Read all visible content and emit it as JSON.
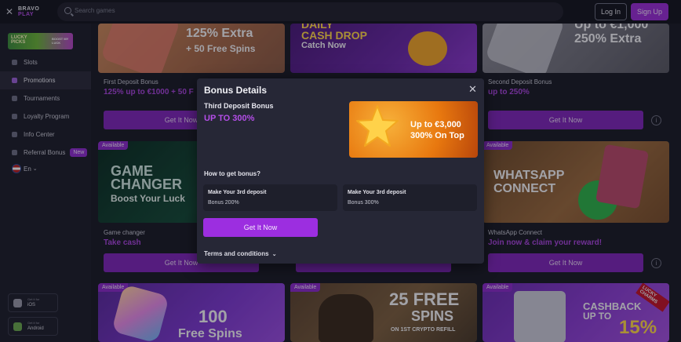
{
  "header": {
    "logo_line1": "BRAVO",
    "logo_line2": "PLAY",
    "search_placeholder": "Search games",
    "login_label": "Log In",
    "signup_label": "Sign Up"
  },
  "sidebar": {
    "promo_banner_line1": "LUCKY",
    "promo_banner_line2": "PICKS",
    "promo_banner_cta": "BOOST MY LUCK",
    "items": [
      {
        "label": "Slots",
        "icon": "slots-icon"
      },
      {
        "label": "Promotions",
        "icon": "promotions-icon",
        "active": true
      },
      {
        "label": "Tournaments",
        "icon": "trophy-icon"
      },
      {
        "label": "Loyalty Program",
        "icon": "crown-icon"
      },
      {
        "label": "Info Center",
        "icon": "info-icon"
      },
      {
        "label": "Referral Bonus",
        "icon": "referral-icon",
        "badge": "New"
      }
    ],
    "language": "En",
    "apps": [
      {
        "line1": "Get it for",
        "line2": "iOS",
        "icon": "apple-icon"
      },
      {
        "line1": "Get it for",
        "line2": "Android",
        "icon": "android-icon"
      }
    ]
  },
  "cards": {
    "first_deposit": {
      "banner_l1": "125% Extra",
      "banner_l2": "+ 50 Free Spins",
      "title": "First Deposit Bonus",
      "sub": "125% up to €1000 + 50 F",
      "btn": "Get It Now"
    },
    "daily_cash": {
      "banner_l1": "DAILY",
      "banner_l2": "CASH DROP",
      "banner_l3": "Catch Now"
    },
    "second_deposit": {
      "banner_l1": "Up to €1,000",
      "banner_l2": "250% Extra",
      "title": "Second Deposit Bonus",
      "sub": "up to 250%",
      "btn": "Get It Now"
    },
    "game_changer": {
      "badge": "Available",
      "banner_l1": "GAME",
      "banner_l2": "CHANGER",
      "banner_l3": "Boost Your Luck",
      "title": "Game changer",
      "sub": "Take cash",
      "btn": "Get It Now"
    },
    "whatsapp": {
      "badge": "Available",
      "banner_l1": "WHATSAPP",
      "banner_l2": "CONNECT",
      "title": "WhatsApp Connect",
      "sub": "Join now & claim your reward!",
      "btn": "Get It Now"
    },
    "free_spins_100": {
      "badge": "Available",
      "banner_l1": "100",
      "banner_l2": "Free Spins"
    },
    "free_spins_25": {
      "badge": "Available",
      "banner_l1": "25 FREE",
      "banner_l2": "SPINS",
      "banner_l3": "ON 1ST CRYPTO REFILL"
    },
    "cashback": {
      "badge": "Available",
      "banner_l1": "CASHBACK",
      "banner_l2": "UP TO",
      "banner_l3": "15%",
      "corner": "LUCKY CHARMS"
    }
  },
  "modal": {
    "title": "Bonus Details",
    "bonus_name": "Third Deposit Bonus",
    "bonus_value": "UP TO 300%",
    "banner_line1": "Up to €3,000",
    "banner_line2": "300% On Top",
    "how_to": "How to get bonus?",
    "steps": [
      {
        "title": "Make Your 3rd deposit",
        "desc": "Bonus 200%"
      },
      {
        "title": "Make Your 3rd deposit",
        "desc": "Bonus 300%"
      }
    ],
    "cta": "Get It Now",
    "terms": "Terms and conditions"
  }
}
